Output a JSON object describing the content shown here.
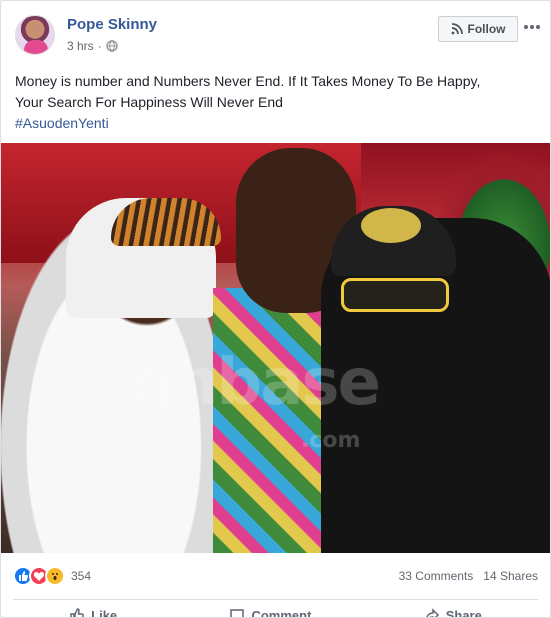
{
  "author": {
    "name": "Pope Skinny",
    "time": "3 hrs"
  },
  "follow": {
    "label": "Follow"
  },
  "post": {
    "text_line_1": "Money is number and Numbers Never End. If It Takes Money To Be Happy,",
    "text_line_2": "Your Search For Happiness Will Never End",
    "hashtag": "#AsuodenYenti"
  },
  "photo": {
    "watermark_text": "ghbase",
    "watermark_suffix": ".com"
  },
  "reactions": {
    "icons": [
      "like-icon",
      "love-icon",
      "wow-icon"
    ],
    "count": "354",
    "comments": "33 Comments",
    "shares": "14 Shares"
  },
  "actions": {
    "like": "Like",
    "comment": "Comment",
    "share": "Share"
  }
}
